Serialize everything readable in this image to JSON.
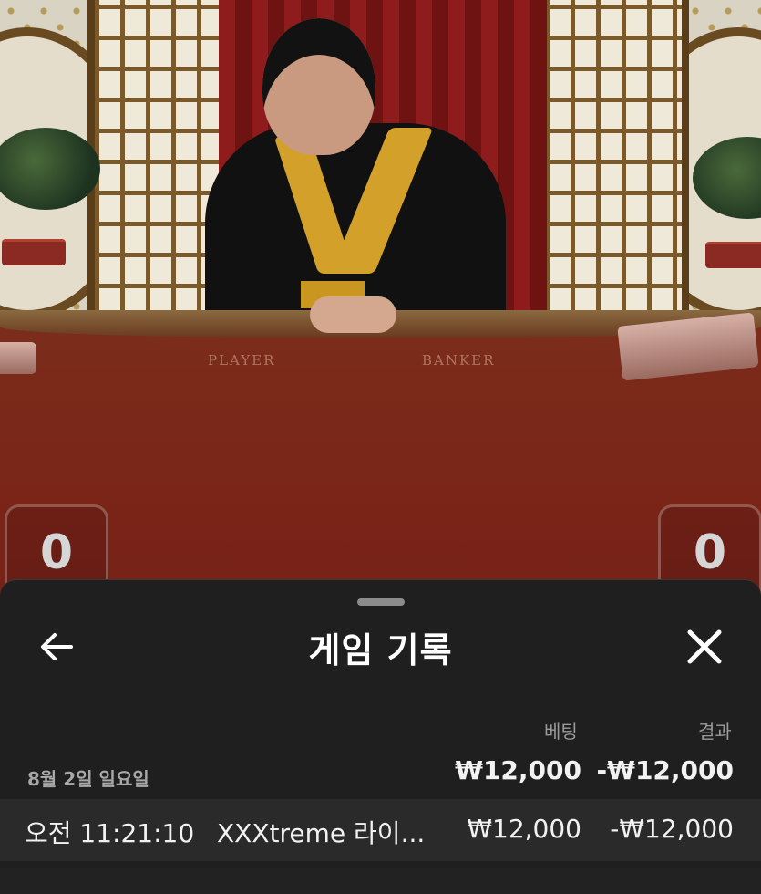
{
  "stage": {
    "table_labels": {
      "player": "PLAYER",
      "banker": "BANKER"
    },
    "scores": {
      "player": "0",
      "banker": "0"
    }
  },
  "sheet": {
    "title": "게임 기록",
    "back_icon": "arrow-left-icon",
    "close_icon": "close-icon",
    "columns": {
      "bet": "베팅",
      "result": "결과"
    },
    "days": [
      {
        "label": "8월 2일 일요일",
        "total_bet": "₩12,000",
        "total_result": "-₩12,000",
        "rows": [
          {
            "time": "오전 11:21:10",
            "game": "XXXtreme 라이...",
            "bet": "₩12,000",
            "result": "-₩12,000"
          }
        ]
      }
    ]
  },
  "colors": {
    "sheet_bg": "#1f1f1f",
    "row_bg": "#2a2a2a",
    "text": "#f2f2f2",
    "muted": "#9a9a9a"
  }
}
